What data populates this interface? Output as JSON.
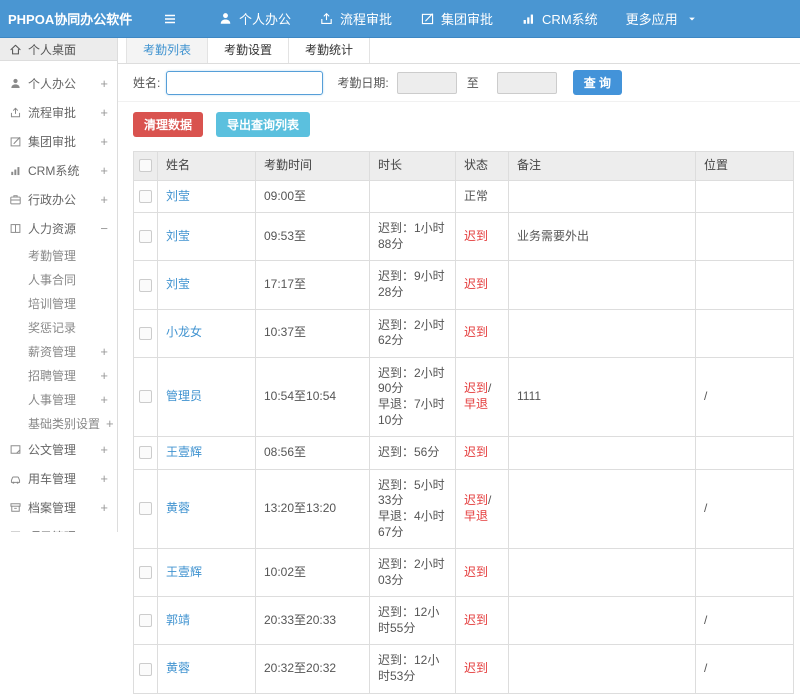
{
  "app": {
    "title": "PHPOA协同办公软件"
  },
  "colors": {
    "navbar": "#4a96d2",
    "link": "#4093d0",
    "primary_button": "#4393d9",
    "danger_button": "#d9534f",
    "info_button": "#5bc0de",
    "status_late": "#e43b3b"
  },
  "navbar": {
    "menu_icon": "menu-icon",
    "items": [
      {
        "label": "个人办公",
        "icon": "user-icon"
      },
      {
        "label": "流程审批",
        "icon": "process-icon"
      },
      {
        "label": "集团审批",
        "icon": "approval-icon"
      },
      {
        "label": "CRM系统",
        "icon": "chart-icon"
      },
      {
        "label": "更多应用",
        "icon": "caret-down-icon"
      }
    ]
  },
  "sidebar": {
    "items": [
      {
        "label": "个人桌面",
        "icon": "home-icon",
        "level": "top",
        "active": true
      },
      {
        "label": "个人办公",
        "icon": "user-icon",
        "level": "main",
        "expand": "+"
      },
      {
        "label": "流程审批",
        "icon": "process-icon",
        "level": "main",
        "expand": "+"
      },
      {
        "label": "集团审批",
        "icon": "approval-icon",
        "level": "main",
        "expand": "+"
      },
      {
        "label": "CRM系统",
        "icon": "chart-icon",
        "level": "main",
        "expand": "+"
      },
      {
        "label": "行政办公",
        "icon": "briefcase-icon",
        "level": "main",
        "expand": "+"
      },
      {
        "label": "人力资源",
        "icon": "book-icon",
        "level": "main",
        "expand": "-"
      },
      {
        "label": "考勤管理",
        "level": "sub"
      },
      {
        "label": "人事合同",
        "level": "sub"
      },
      {
        "label": "培训管理",
        "level": "sub"
      },
      {
        "label": "奖惩记录",
        "level": "sub"
      },
      {
        "label": "薪资管理",
        "level": "sub",
        "expand": "+"
      },
      {
        "label": "招聘管理",
        "level": "sub",
        "expand": "+"
      },
      {
        "label": "人事管理",
        "level": "sub",
        "expand": "+"
      },
      {
        "label": "基础类别设置",
        "level": "sub",
        "expand": "+"
      },
      {
        "label": "公文管理",
        "icon": "document-icon",
        "level": "main",
        "expand": "+"
      },
      {
        "label": "用车管理",
        "icon": "car-icon",
        "level": "main",
        "expand": "+"
      },
      {
        "label": "档案管理",
        "icon": "archive-icon",
        "level": "main",
        "expand": "+"
      },
      {
        "label": "项目管理",
        "icon": "project-icon",
        "level": "main",
        "expand": "+"
      }
    ]
  },
  "tabs": [
    {
      "label": "考勤列表",
      "active": true
    },
    {
      "label": "考勤设置",
      "active": false
    },
    {
      "label": "考勤统计",
      "active": false
    }
  ],
  "filter": {
    "name_label": "姓名:",
    "name_value": "",
    "name_placeholder": "",
    "date_label": "考勤日期:",
    "date_from": "",
    "to_label": "至",
    "date_to": "",
    "search_label": "查 询"
  },
  "actions": {
    "clean_label": "清理数据",
    "export_label": "导出查询列表"
  },
  "table": {
    "columns": [
      "姓名",
      "考勤时间",
      "时长",
      "状态",
      "备注",
      "位置"
    ],
    "rows": [
      {
        "name": "刘莹",
        "time": "09:00至",
        "duration": [],
        "status": "正常",
        "status_type": "normal",
        "remark": "",
        "location": ""
      },
      {
        "name": "刘莹",
        "time": "09:53至",
        "duration": [
          "迟到：1小时88分"
        ],
        "status": "迟到",
        "status_type": "late",
        "remark": "业务需要外出",
        "location": ""
      },
      {
        "name": "刘莹",
        "time": "17:17至",
        "duration": [
          "迟到：9小时28分"
        ],
        "status": "迟到",
        "status_type": "late",
        "remark": "",
        "location": ""
      },
      {
        "name": "小龙女",
        "time": "10:37至",
        "duration": [
          "迟到：2小时62分"
        ],
        "status": "迟到",
        "status_type": "late",
        "remark": "",
        "location": ""
      },
      {
        "name": "管理员",
        "time": "10:54至10:54",
        "duration": [
          "迟到：2小时90分",
          "早退：7小时10分"
        ],
        "status": "迟到/早退",
        "status_type": "late",
        "remark": "1111",
        "location": "/"
      },
      {
        "name": "王壹辉",
        "time": "08:56至",
        "duration": [
          "迟到：56分"
        ],
        "status": "迟到",
        "status_type": "late",
        "remark": "",
        "location": ""
      },
      {
        "name": "黄蓉",
        "time": "13:20至13:20",
        "duration": [
          "迟到：5小时33分",
          "早退：4小时67分"
        ],
        "status": "迟到/早退",
        "status_type": "late",
        "remark": "",
        "location": "/"
      },
      {
        "name": "王壹辉",
        "time": "10:02至",
        "duration": [
          "迟到：2小时03分"
        ],
        "status": "迟到",
        "status_type": "late",
        "remark": "",
        "location": ""
      },
      {
        "name": "郭靖",
        "time": "20:33至20:33",
        "duration": [
          "迟到：12小时55分"
        ],
        "status": "迟到",
        "status_type": "late",
        "remark": "",
        "location": "/"
      },
      {
        "name": "黄蓉",
        "time": "20:32至20:32",
        "duration": [
          "迟到：12小时53分"
        ],
        "status": "迟到",
        "status_type": "late",
        "remark": "",
        "location": "/"
      }
    ]
  }
}
